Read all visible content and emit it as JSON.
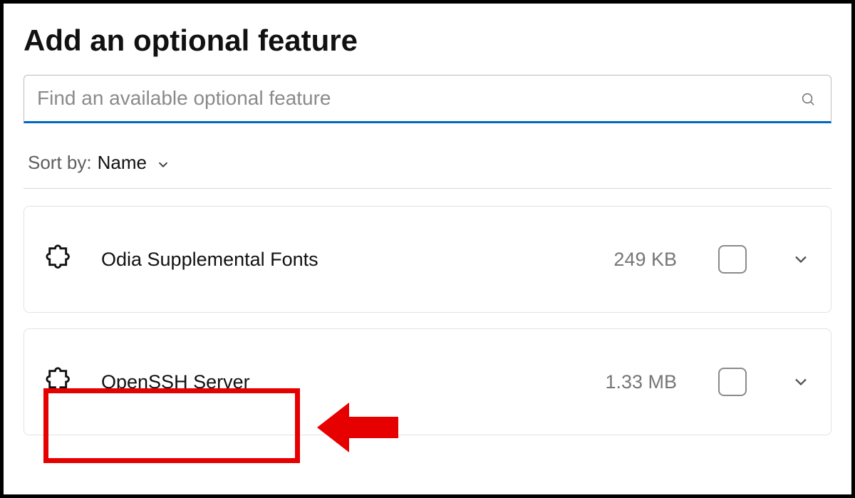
{
  "header": {
    "title": "Add an optional feature"
  },
  "search": {
    "placeholder": "Find an available optional feature",
    "value": ""
  },
  "sort": {
    "label": "Sort by:",
    "value": "Name"
  },
  "features": [
    {
      "name": "Odia Supplemental Fonts",
      "size": "249 KB",
      "checked": false
    },
    {
      "name": "OpenSSH Server",
      "size": "1.33 MB",
      "checked": false
    }
  ],
  "annotation": {
    "highlight_color": "#e60000",
    "target_index": 1
  }
}
